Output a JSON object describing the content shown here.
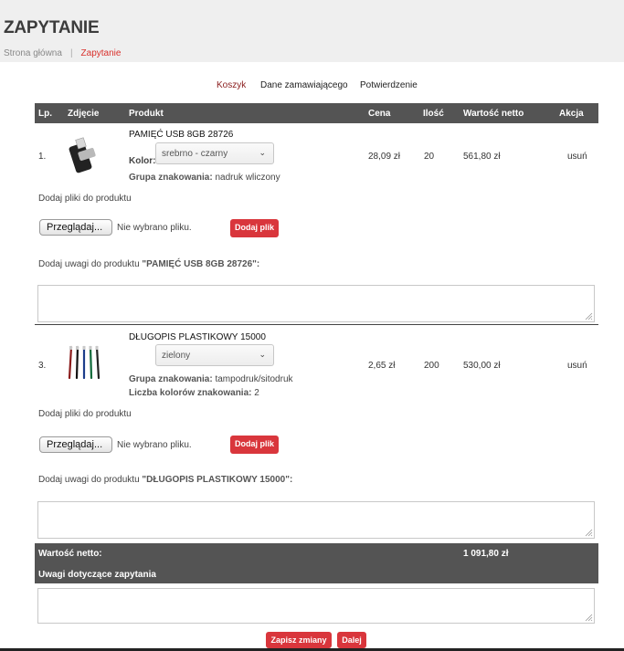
{
  "header": {
    "title": "ZAPYTANIE",
    "breadcrumb": {
      "home": "Strona główna",
      "separator": "|",
      "current": "Zapytanie"
    }
  },
  "steps": [
    "Koszyk",
    "Dane zamawiającego",
    "Potwierdzenie"
  ],
  "table": {
    "columns": [
      "Lp.",
      "Zdjęcie",
      "Produkt",
      "Cena",
      "Ilość",
      "Wartość netto",
      "Akcja"
    ]
  },
  "products": [
    {
      "lp": "1.",
      "name": "PAMIĘĆ USB 8GB 28726",
      "color_label": "Kolor:",
      "color_value": "srebrno - czarny",
      "group_label": "Grupa znakowania:",
      "group_value": "nadruk wliczony",
      "price": "28,09 zł",
      "qty": "20",
      "value": "561,80 zł",
      "action": "usuń",
      "files_label": "Dodaj pliki do produktu",
      "browse_label": "Przeglądaj...",
      "no_file": "Nie wybrano pliku.",
      "add_file": "Dodaj plik",
      "notes_prefix": "Dodaj uwagi do produktu ",
      "notes_name": "\"PAMIĘĆ USB 8GB 28726\":",
      "image_icon": "usb-drive-icon"
    },
    {
      "lp": "3.",
      "name": "DŁUGOPIS PLASTIKOWY 15000",
      "color_value": "zielony",
      "group_label": "Grupa znakowania:",
      "group_value": "tampodruk/sitodruk",
      "colors_count_label": "Liczba kolorów znakowania:",
      "colors_count_value": "2",
      "price": "2,65 zł",
      "qty": "200",
      "value": "530,00 zł",
      "action": "usuń",
      "files_label": "Dodaj pliki do produktu",
      "browse_label": "Przeglądaj...",
      "no_file": "Nie wybrano pliku.",
      "add_file": "Dodaj plik",
      "notes_prefix": "Dodaj uwagi do produktu ",
      "notes_name": "\"DŁUGOPIS PLASTIKOWY 15000\":",
      "image_icon": "pens-icon"
    }
  ],
  "summary": {
    "net_label": "Wartość netto:",
    "net_value": "1 091,80 zł",
    "notes_label": "Uwagi dotyczące zapytania"
  },
  "buttons": {
    "save": "Zapisz zmiany",
    "next": "Dalej"
  },
  "colors": {
    "accent": "#d9363c",
    "dark_bar": "#545454",
    "breadcrumb_active": "#d9302c"
  }
}
